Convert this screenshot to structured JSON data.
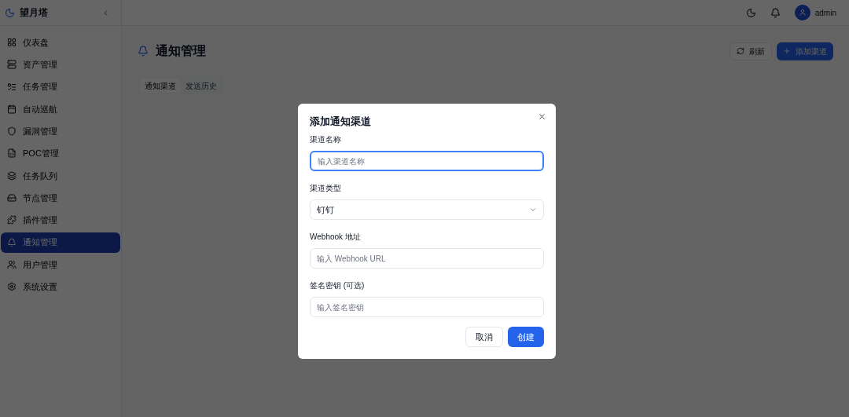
{
  "app": {
    "name": "望月塔"
  },
  "sidebar": {
    "items": [
      {
        "label": "仪表盘",
        "selected": false
      },
      {
        "label": "资产管理",
        "selected": false
      },
      {
        "label": "任务管理",
        "selected": false
      },
      {
        "label": "自动巡航",
        "selected": false
      },
      {
        "label": "漏洞管理",
        "selected": false
      },
      {
        "label": "POC管理",
        "selected": false
      },
      {
        "label": "任务队列",
        "selected": false
      },
      {
        "label": "节点管理",
        "selected": false
      },
      {
        "label": "插件管理",
        "selected": false
      },
      {
        "label": "通知管理",
        "selected": true
      },
      {
        "label": "用户管理",
        "selected": false
      },
      {
        "label": "系统设置",
        "selected": false
      }
    ]
  },
  "header": {
    "user": "admin"
  },
  "page": {
    "title": "通知管理",
    "actions": [
      {
        "label": "刷新",
        "kind": "outline"
      },
      {
        "label": "添加渠道",
        "kind": "primary"
      }
    ],
    "tabs": [
      {
        "label": "通知渠道",
        "selected": true
      },
      {
        "label": "发送历史",
        "selected": false
      }
    ]
  },
  "dialog": {
    "title": "添加通知渠道",
    "fields": [
      {
        "label": "渠道名称",
        "kind": "input",
        "placeholder": "输入渠道名称",
        "focused": true
      },
      {
        "label": "渠道类型",
        "kind": "select",
        "value": "钉钉"
      },
      {
        "label": "Webhook 地址",
        "kind": "input",
        "placeholder": "输入 Webhook URL",
        "focused": false
      },
      {
        "label": "签名密钥 (可选)",
        "kind": "input",
        "placeholder": "输入签名密钥",
        "focused": false
      }
    ],
    "buttons": [
      {
        "label": "取消",
        "kind": "outline"
      },
      {
        "label": "创建",
        "kind": "primary"
      }
    ]
  }
}
